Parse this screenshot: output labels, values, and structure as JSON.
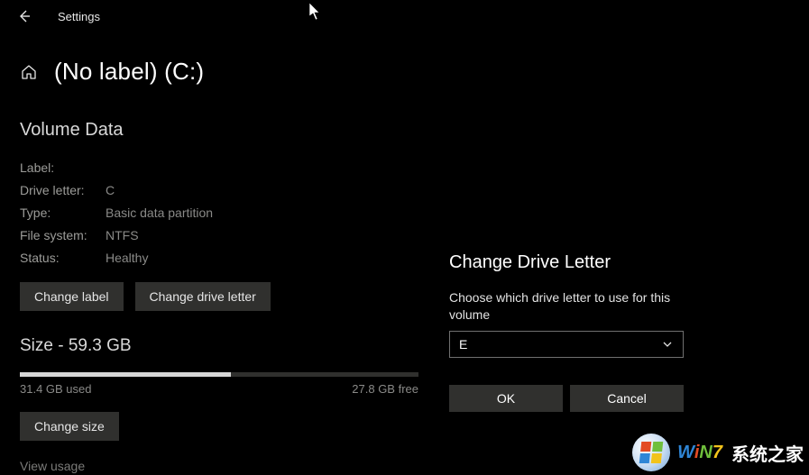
{
  "topbar": {
    "title": "Settings"
  },
  "page": {
    "title": "(No label) (C:)",
    "volume_heading": "Volume Data",
    "kv": {
      "label_key": "Label:",
      "label_val": "",
      "drive_key": "Drive letter:",
      "drive_val": "C",
      "type_key": "Type:",
      "type_val": "Basic data partition",
      "fs_key": "File system:",
      "fs_val": "NTFS",
      "status_key": "Status:",
      "status_val": "Healthy"
    },
    "buttons": {
      "change_label": "Change label",
      "change_drive_letter": "Change drive letter"
    },
    "size_heading": "Size - 59.3 GB",
    "usage": {
      "used_label": "31.4 GB used",
      "free_label": "27.8 GB free",
      "used_pct": 53
    },
    "change_size": "Change size",
    "view_usage": "View usage"
  },
  "dialog": {
    "title": "Change Drive Letter",
    "text": "Choose which drive letter to use for this volume",
    "selected": "E",
    "ok": "OK",
    "cancel": "Cancel"
  },
  "watermark": {
    "brand": "WiN7",
    "rest": "系统之家"
  }
}
